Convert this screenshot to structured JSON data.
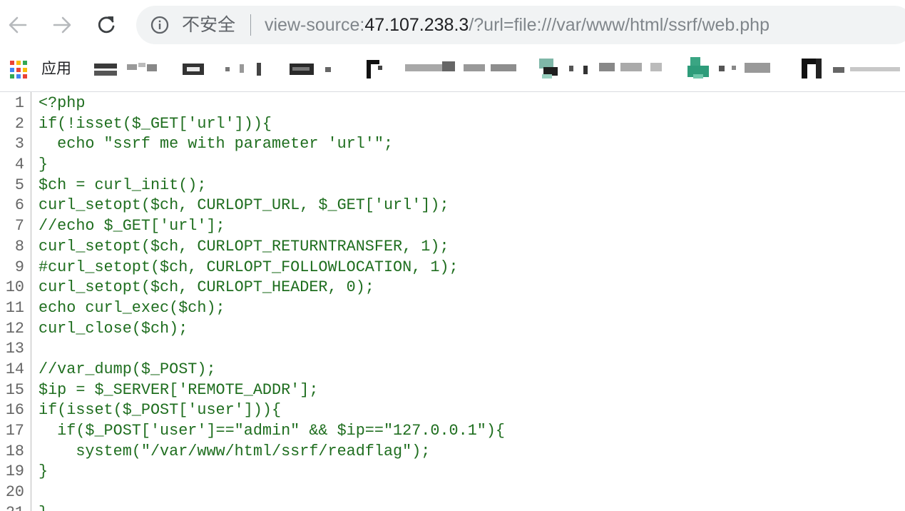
{
  "browser": {
    "nav": {
      "back_icon": "arrow-left-icon",
      "forward_icon": "arrow-right-icon",
      "reload_icon": "reload-icon"
    },
    "omnibox": {
      "info_icon": "info-icon",
      "security_label": "不安全",
      "url_prefix": "view-source:",
      "url_host": "47.107.238.3",
      "url_rest": "/?url=file:///var/www/html/ssrf/web.php"
    },
    "bookmarks": {
      "apps_icon": "apps-grid-icon",
      "apps_label": "应用"
    }
  },
  "source": {
    "lines": [
      "<?php",
      "if(!isset($_GET['url'])){",
      "  echo \"ssrf me with parameter 'url'\";",
      "}",
      "$ch = curl_init();",
      "curl_setopt($ch, CURLOPT_URL, $_GET['url']);",
      "//echo $_GET['url'];",
      "curl_setopt($ch, CURLOPT_RETURNTRANSFER, 1);",
      "#curl_setopt($ch, CURLOPT_FOLLOWLOCATION, 1);",
      "curl_setopt($ch, CURLOPT_HEADER, 0);",
      "echo curl_exec($ch);",
      "curl_close($ch);",
      "",
      "//var_dump($_POST);",
      "$ip = $_SERVER['REMOTE_ADDR'];",
      "if(isset($_POST['user'])){",
      "  if($_POST['user']==\"admin\" && $ip==\"127.0.0.1\"){",
      "    system(\"/var/www/html/ssrf/readflag\");",
      "}",
      "",
      "}"
    ]
  },
  "colors": {
    "code_text": "#1f6e1f",
    "line_number": "#666666",
    "omnibox_bg": "#f1f3f4"
  }
}
